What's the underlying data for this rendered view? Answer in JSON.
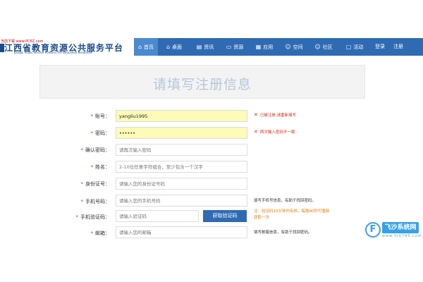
{
  "header": {
    "tiny_text": "当前下载 www.PC6Z.com",
    "logo_title": "江西省教育资源公共服务平台",
    "logo_subtitle": "Jiangxi Public Service Platform For Education Resources",
    "nav": [
      {
        "label": "首页",
        "icon": "home-icon",
        "glyph": "⌂",
        "active": true
      },
      {
        "label": "桌面",
        "icon": "desktop-icon",
        "glyph": "⌂",
        "active": false
      },
      {
        "label": "资讯",
        "icon": "news-icon",
        "glyph": "▤",
        "active": false
      },
      {
        "label": "资源",
        "icon": "folder-icon",
        "glyph": "▭",
        "active": false
      },
      {
        "label": "应用",
        "icon": "apps-icon",
        "glyph": "▦",
        "active": false
      },
      {
        "label": "空间",
        "icon": "user-icon",
        "glyph": "☺",
        "active": false
      },
      {
        "label": "社区",
        "icon": "community-icon",
        "glyph": "☺",
        "active": false
      },
      {
        "label": "活动",
        "icon": "chat-icon",
        "glyph": "▢",
        "active": false
      }
    ],
    "login": "登录",
    "register": "注册"
  },
  "form": {
    "title": "请填写注册信息",
    "fields": {
      "account": {
        "label": "账号：",
        "value": "yangliu1995",
        "placeholder": "",
        "required": true
      },
      "password": {
        "label": "密码：",
        "value": "••••••",
        "placeholder": "",
        "required": true
      },
      "confirm": {
        "label": "确认密码：",
        "value": "",
        "placeholder": "请再次输入密码",
        "required": true
      },
      "name": {
        "label": "姓名：",
        "value": "",
        "placeholder": "2-10位任意字符组合，至少包含一个汉字",
        "required": true
      },
      "idcard": {
        "label": "身份证号：",
        "value": "",
        "placeholder": "请输入您的身份证号码",
        "required": true
      },
      "phone": {
        "label": "手机号码：",
        "value": "",
        "placeholder": "请输入您的手机号码",
        "required": true
      },
      "sms": {
        "label": "手机验证码：",
        "value": "",
        "placeholder": "请输入验证码",
        "required": true
      },
      "email": {
        "label": "邮箱：",
        "value": "",
        "placeholder": "请输入您的邮箱",
        "required": true
      }
    },
    "errors": {
      "account": "已被注册,请重新填写",
      "password": "两次输入密码不一致"
    },
    "hints": {
      "phone": "填写手机号信息，有助于找回密码。",
      "sms": "注：验证码10分钟内有效，每隔90秒可重新获取一次",
      "email": "填写邮箱信息，有助于找回密码。"
    },
    "get_code_button": "获取验证码"
  },
  "watermark": {
    "text": "飞沙系统网",
    "url": "www.fs0745.com",
    "glyph": "F"
  }
}
